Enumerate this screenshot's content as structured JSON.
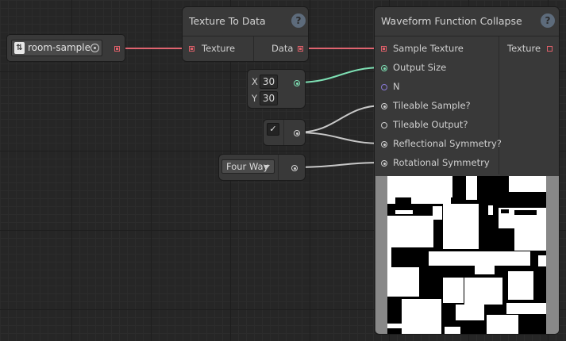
{
  "asset_node": {
    "value": "room-sample",
    "icon": "texture-asset-icon",
    "picker_icon": "object-picker-icon"
  },
  "texture_to_data": {
    "title": "Texture To Data",
    "help": "?",
    "input_label": "Texture",
    "output_label": "Data"
  },
  "vector_node": {
    "x_label": "X",
    "x_value": "30",
    "y_label": "Y",
    "y_value": "30"
  },
  "toggle_node": {
    "checked": "✓"
  },
  "enum_node": {
    "value": "Four Way"
  },
  "wfc": {
    "title": "Waveform Function Collapse",
    "help": "?",
    "inputs": [
      "Sample Texture",
      "Output Size",
      "N",
      "Tileable Sample?",
      "Tileable Output?",
      "Reflectional Symmetry?",
      "Rotational Symmetry"
    ],
    "output_label": "Texture"
  },
  "colors": {
    "texture_wire": "#e06470",
    "vector_wire": "#7ee0b4",
    "bool_wire": "#c8c8c8",
    "texture_port": "#e0606a"
  },
  "preview": {
    "type": "binary-texture",
    "colors": [
      "#000000",
      "#ffffff"
    ]
  }
}
